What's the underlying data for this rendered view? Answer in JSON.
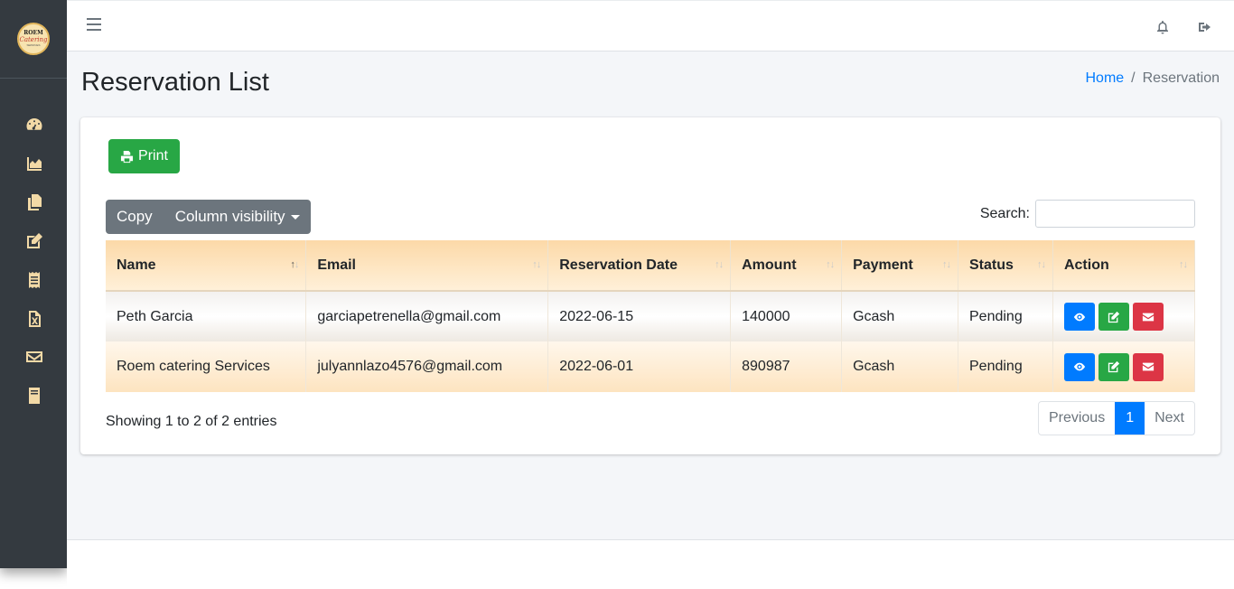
{
  "brand": {
    "logo_top": "ROEM",
    "logo_script": "Catering",
    "logo_bottom": "SERVICES"
  },
  "sidebar": {
    "items": [
      {
        "icon": "dashboard-icon"
      },
      {
        "icon": "area-chart-icon"
      },
      {
        "icon": "copy-icon"
      },
      {
        "icon": "edit-icon"
      },
      {
        "icon": "receipt-icon"
      },
      {
        "icon": "excel-file-icon"
      },
      {
        "icon": "envelope-icon"
      },
      {
        "icon": "book-icon"
      }
    ]
  },
  "topbar": {
    "menu_icon": "hamburger-icon",
    "notification_icon": "bell-icon",
    "logout_icon": "sign-out-icon"
  },
  "page": {
    "title": "Reservation List",
    "breadcrumb": {
      "home": "Home",
      "separator": "/",
      "current": "Reservation"
    }
  },
  "toolbar": {
    "print_label": "Print",
    "copy_label": "Copy",
    "column_visibility_label": "Column visibility",
    "search_label": "Search:",
    "search_value": ""
  },
  "table": {
    "columns": [
      "Name",
      "Email",
      "Reservation Date",
      "Amount",
      "Payment",
      "Status",
      "Action"
    ],
    "rows": [
      {
        "name": "Peth Garcia",
        "email": "garciapetrenella@gmail.com",
        "date": "2022-06-15",
        "amount": "140000",
        "payment": "Gcash",
        "status": "Pending"
      },
      {
        "name": "Roem catering Services",
        "email": "julyannlazo4576@gmail.com",
        "date": "2022-06-01",
        "amount": "890987",
        "payment": "Gcash",
        "status": "Pending"
      }
    ]
  },
  "footer_info": {
    "showing": "Showing 1 to 2 of 2 entries",
    "previous": "Previous",
    "page": "1",
    "next": "Next"
  },
  "colors": {
    "sidebar_bg": "#343a40",
    "sidebar_icon": "#f2d9a6",
    "primary": "#007bff",
    "success": "#28a745",
    "danger": "#dc3545",
    "secondary": "#6c757d",
    "header_gradient_top": "#fcd9a8"
  }
}
